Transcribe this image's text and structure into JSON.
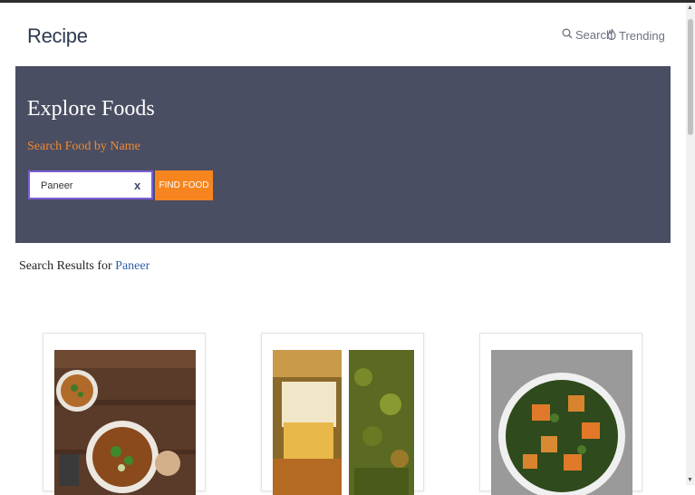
{
  "navbar": {
    "brand": "Recipe",
    "search_label": "Search",
    "trending_label": "Trending"
  },
  "hero": {
    "title": "Explore Foods",
    "subtitle": "Search Food by Name",
    "search_value": "Paneer",
    "clear_label": "x",
    "button_label": "FIND FOOD"
  },
  "results": {
    "prefix": "Search Results for",
    "term": "Paneer"
  },
  "colors": {
    "hero_bg": "#4a4e62",
    "accent": "#f7851f",
    "link": "#2f5fa8"
  }
}
